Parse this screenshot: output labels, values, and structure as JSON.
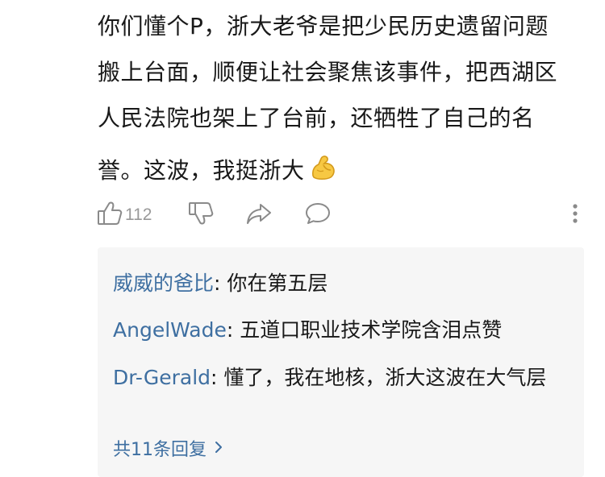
{
  "comment": {
    "lines": [
      "你们懂个P，浙大老爷是把少民历史遗留问题",
      "搬上台面，顺便让社会聚焦该事件，把西湖区",
      "人民法院也架上了台前，还牺牲了自己的名",
      "誉。这波，我挺浙大"
    ],
    "emoji": "flexed-biceps-emoji"
  },
  "actions": {
    "like_count": "112",
    "icons": [
      "thumbs-up-icon",
      "thumbs-down-icon",
      "share-icon",
      "comment-icon",
      "more-vertical-icon"
    ]
  },
  "replies": {
    "items": [
      {
        "user": "威威的爸比",
        "sep": ": ",
        "text": "你在第五层"
      },
      {
        "user": "AngelWade",
        "sep": ": ",
        "text": "五道口职业技术学院含泪点赞"
      },
      {
        "user": "Dr-Gerald",
        "sep": ": ",
        "text": "懂了，我在地核，浙大这波在大气层"
      }
    ],
    "total_label": "共11条回复"
  },
  "colors": {
    "link_blue": "#3e6fa1",
    "text": "#191919",
    "icon_gray": "#8a8a8a",
    "reply_bg": "#f6f6f6"
  }
}
